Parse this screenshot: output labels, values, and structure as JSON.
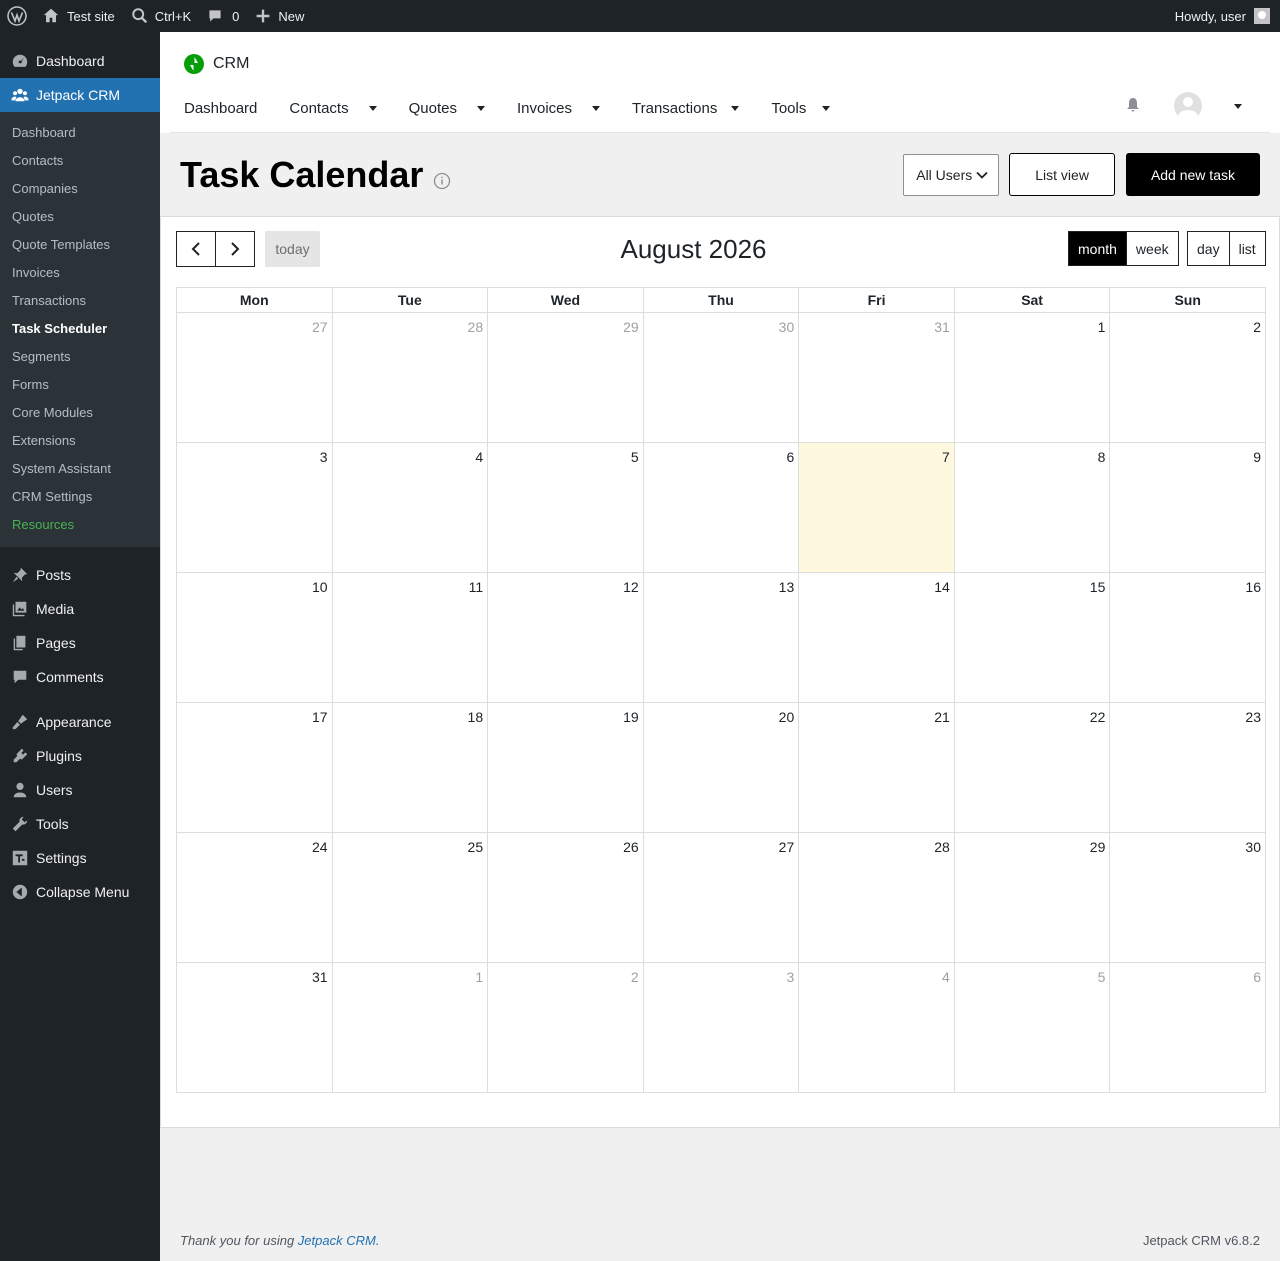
{
  "adminbar": {
    "site_name": "Test site",
    "search_shortcut": "Ctrl+K",
    "comments_count": "0",
    "new_label": "New",
    "greeting": "Howdy, user"
  },
  "sidebar": {
    "top_items": [
      {
        "label": "Dashboard",
        "icon": "dashboard-icon"
      },
      {
        "label": "Jetpack CRM",
        "icon": "people-icon",
        "current": true
      }
    ],
    "submenu": [
      {
        "label": "Dashboard"
      },
      {
        "label": "Contacts"
      },
      {
        "label": "Companies"
      },
      {
        "label": "Quotes"
      },
      {
        "label": "Quote Templates"
      },
      {
        "label": "Invoices"
      },
      {
        "label": "Transactions"
      },
      {
        "label": "Task Scheduler",
        "current": true
      },
      {
        "label": "Segments"
      },
      {
        "label": "Forms"
      },
      {
        "label": "Core Modules"
      },
      {
        "label": "Extensions"
      },
      {
        "label": "System Assistant"
      },
      {
        "label": "CRM Settings"
      },
      {
        "label": "Resources",
        "color": "#46b450"
      }
    ],
    "bottom_items": [
      {
        "label": "Posts",
        "icon": "pushpin-icon"
      },
      {
        "label": "Media",
        "icon": "media-icon"
      },
      {
        "label": "Pages",
        "icon": "pages-icon"
      },
      {
        "label": "Comments",
        "icon": "comment-icon"
      },
      {
        "label": "Appearance",
        "icon": "paintbrush-icon"
      },
      {
        "label": "Plugins",
        "icon": "plugin-icon"
      },
      {
        "label": "Users",
        "icon": "user-icon"
      },
      {
        "label": "Tools",
        "icon": "wrench-icon"
      },
      {
        "label": "Settings",
        "icon": "settings-icon"
      },
      {
        "label": "Collapse Menu",
        "icon": "collapse-icon"
      }
    ]
  },
  "crm": {
    "brand": "CRM",
    "nav": [
      "Dashboard",
      "Contacts",
      "Quotes",
      "Invoices",
      "Transactions",
      "Tools"
    ]
  },
  "page": {
    "title": "Task Calendar",
    "users_select": "All Users",
    "list_view_label": "List view",
    "add_task_label": "Add new task"
  },
  "calendar": {
    "title": "August 2026",
    "today_label": "today",
    "views": [
      "month",
      "week",
      "day",
      "list"
    ],
    "active_view": "month",
    "weekdays": [
      "Mon",
      "Tue",
      "Wed",
      "Thu",
      "Fri",
      "Sat",
      "Sun"
    ],
    "weeks": [
      [
        {
          "d": "27",
          "o": true
        },
        {
          "d": "28",
          "o": true
        },
        {
          "d": "29",
          "o": true
        },
        {
          "d": "30",
          "o": true
        },
        {
          "d": "31",
          "o": true
        },
        {
          "d": "1"
        },
        {
          "d": "2"
        }
      ],
      [
        {
          "d": "3"
        },
        {
          "d": "4"
        },
        {
          "d": "5"
        },
        {
          "d": "6"
        },
        {
          "d": "7",
          "t": true
        },
        {
          "d": "8"
        },
        {
          "d": "9"
        }
      ],
      [
        {
          "d": "10"
        },
        {
          "d": "11"
        },
        {
          "d": "12"
        },
        {
          "d": "13"
        },
        {
          "d": "14"
        },
        {
          "d": "15"
        },
        {
          "d": "16"
        }
      ],
      [
        {
          "d": "17"
        },
        {
          "d": "18"
        },
        {
          "d": "19"
        },
        {
          "d": "20"
        },
        {
          "d": "21"
        },
        {
          "d": "22"
        },
        {
          "d": "23"
        }
      ],
      [
        {
          "d": "24"
        },
        {
          "d": "25"
        },
        {
          "d": "26"
        },
        {
          "d": "27"
        },
        {
          "d": "28"
        },
        {
          "d": "29"
        },
        {
          "d": "30"
        }
      ],
      [
        {
          "d": "31"
        },
        {
          "d": "1",
          "o": true
        },
        {
          "d": "2",
          "o": true
        },
        {
          "d": "3",
          "o": true
        },
        {
          "d": "4",
          "o": true
        },
        {
          "d": "5",
          "o": true
        },
        {
          "d": "6",
          "o": true
        }
      ]
    ]
  },
  "footer": {
    "thanks_prefix": "Thank you for using ",
    "thanks_link": "Jetpack CRM",
    "thanks_suffix": ".",
    "version": "Jetpack CRM v6.8.2"
  }
}
